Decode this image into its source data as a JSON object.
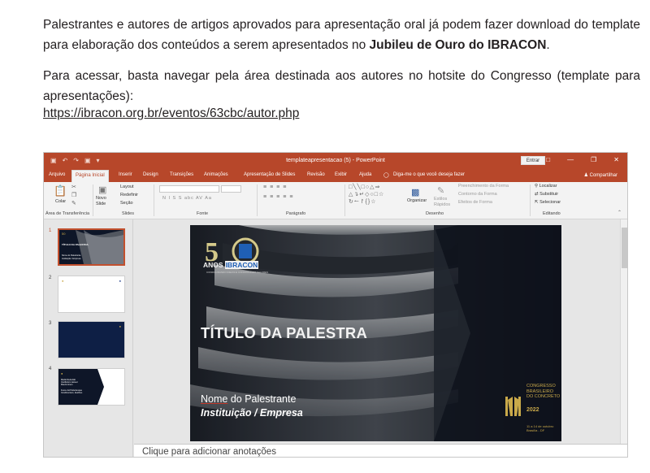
{
  "article": {
    "para1_text": "Palestrantes e autores de artigos aprovados para apresentação oral já podem fazer download do template para elaboração dos conteúdos a serem apresentados no ",
    "para1_bold": "Jubileu de Ouro do IBRACON",
    "para1_end": ".",
    "para2_text": "Para acessar, basta navegar pela área destinada aos autores no hotsite do Congresso (template para apresentações):",
    "link": "https://ibracon.org.br/eventos/63cbc/autor.php"
  },
  "window": {
    "title": "templateapresentacao (5)  -  PowerPoint",
    "signin_button": "Entrar",
    "tabs": [
      "Arquivo",
      "Página Inicial",
      "Inserir",
      "Design",
      "Transições",
      "Animações",
      "Apresentação de Slides",
      "Revisão",
      "Exibir",
      "Ajuda"
    ],
    "active_tab": "Página Inicial",
    "tell_me": "Diga-me o que você deseja fazer",
    "share": "Compartilhar",
    "accent": "#b7472a"
  },
  "ribbon": {
    "clipboard": {
      "paste": "Colar",
      "label": "Área de Transferência"
    },
    "slides": {
      "new_slide": "Novo Slide",
      "layout": "Layout",
      "reset": "Redefinir",
      "section": "Seção",
      "label": "Slides"
    },
    "font": {
      "label": "Fonte",
      "buttons": "N  I  S  S  abc  AV  Aa"
    },
    "paragraph": {
      "label": "Parágrafo"
    },
    "drawing": {
      "arrange": "Organizar",
      "quick_styles": "Estilos Rápidos",
      "fill": "Preenchimento da Forma",
      "outline": "Contorno da Forma",
      "effects": "Efeitos de Forma",
      "label": "Desenho"
    },
    "editing": {
      "find": "Localizar",
      "replace": "Substituir",
      "select": "Selecionar",
      "label": "Editando"
    }
  },
  "thumbnails": [
    {
      "num": "1",
      "bg": "#0e1628",
      "lines": [
        "TÍTULO DA PALESTRA",
        "Nome do Palestrante",
        "Instituição / Empresa"
      ]
    },
    {
      "num": "2",
      "bg": "#ffffff",
      "lines": []
    },
    {
      "num": "3",
      "bg": "#0e1f45",
      "lines": []
    },
    {
      "num": "4",
      "bg": "#ffffff",
      "lines": [
        "Médio Reduzido",
        "Vestibulum laoreet",
        "Mauris lorem",
        "Fusce dui Pellentesque",
        "Condimentum, faucibus"
      ]
    }
  ],
  "slide": {
    "logo_number": "50",
    "logo_anos": "ANOS",
    "logo_org": "IBRACON",
    "logo_tagline": "CONFIGURANDO IDEIAS E CONSTRUINDO VALORES",
    "title": "TÍTULO DA PALESTRA",
    "speaker_underlined": "Nome",
    "speaker_rest": " do Palestrante",
    "institution": "Instituição / Empresa",
    "congress_lines": [
      "CONGRESSO",
      "BRASILEIRO",
      "DO CONCRETO"
    ],
    "congress_year": "2022",
    "congress_dates": "11 a 14 de outubro",
    "congress_place": "Brasília - DF"
  },
  "notes_placeholder": "Clique para adicionar anotações"
}
